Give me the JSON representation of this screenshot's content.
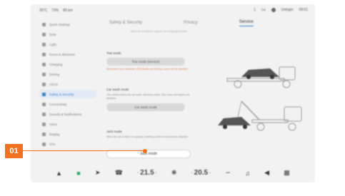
{
  "statusbar": {
    "left_items": [
      "26°C",
      "73%",
      "85 km"
    ],
    "right_items": [
      "1",
      "Lu",
      "Unlogin",
      "09:51"
    ]
  },
  "sidebar": {
    "items": [
      {
        "label": "Quick Settings",
        "icon": "toggle-icon",
        "active": false
      },
      {
        "label": "Seat",
        "icon": "seat-icon",
        "active": false
      },
      {
        "label": "Light",
        "icon": "light-icon",
        "active": false
      },
      {
        "label": "Doors & Windows",
        "icon": "door-icon",
        "active": false
      },
      {
        "label": "Charging",
        "icon": "charging-icon",
        "active": false
      },
      {
        "label": "Driving",
        "icon": "steering-icon",
        "active": false
      },
      {
        "label": "ADAS",
        "icon": "adas-icon",
        "active": false
      },
      {
        "label": "Safety & Security",
        "icon": "shield-icon",
        "active": true
      },
      {
        "label": "Connectivity",
        "icon": "wifi-icon",
        "active": false
      },
      {
        "label": "Sounds & Notifications",
        "icon": "sound-icon",
        "active": false
      },
      {
        "label": "Voice",
        "icon": "mic-icon",
        "active": false
      },
      {
        "label": "Display",
        "icon": "display-icon",
        "active": false
      },
      {
        "label": "OTA",
        "icon": "update-icon",
        "active": false
      }
    ]
  },
  "tabs": [
    {
      "label": "Safety & Security",
      "active": false
    },
    {
      "label": "Privacy",
      "active": false
    },
    {
      "label": "Service",
      "active": true
    }
  ],
  "tab_desc": "Need air-conditioner support, so on garage presets",
  "tow": {
    "title": "Tow mode",
    "button": "Tow mode (service)",
    "warning": "Remember your seatbelts. PRK/Brake and driving modes will be disabled."
  },
  "wash": {
    "title": "Car wash mode",
    "desc": "The vehicle enters the car wash. Windows close, door locks and wipers are disabled.",
    "button": "Car wash mode"
  },
  "jack": {
    "title": "Jack mode",
    "desc": "When the car is lifted on a jack(s), levelling control is temporarily disabled",
    "button": "Jack mode"
  },
  "bottombar": {
    "temp_left": "21.5",
    "temp_right": "20.5"
  },
  "callout": {
    "label": "01"
  },
  "colors": {
    "accent": "#3b82c4",
    "callout": "#f37021",
    "warning": "#e07a56"
  }
}
